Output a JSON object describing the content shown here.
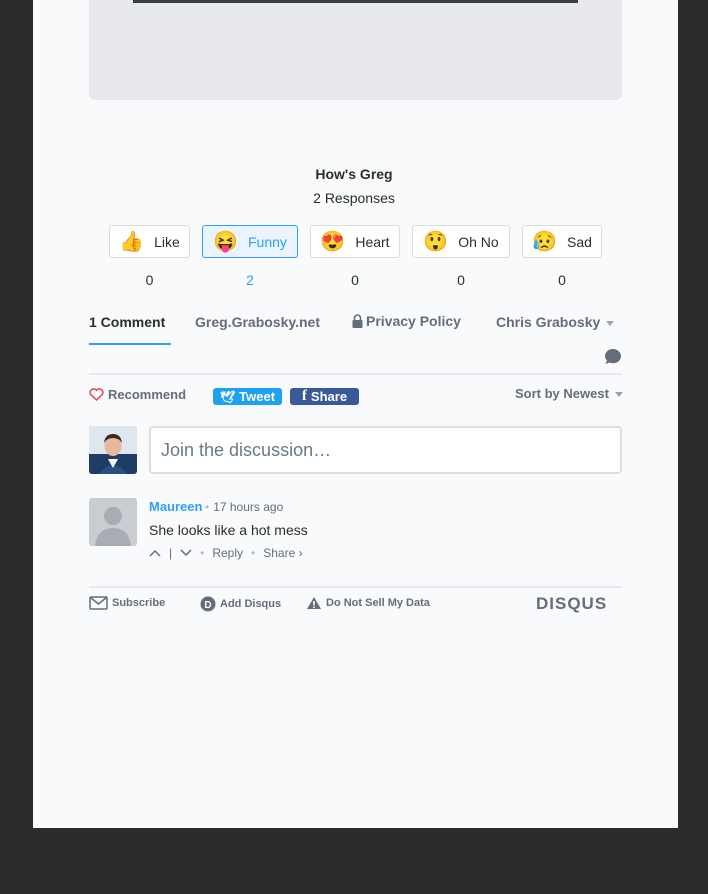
{
  "reactions": {
    "title": "How's Greg",
    "responses": "2 Responses",
    "items": [
      {
        "label": "Like",
        "count": "0",
        "emoji": "👍",
        "icon": "thumbs-up-icon"
      },
      {
        "label": "Funny",
        "count": "2",
        "emoji": "😝",
        "icon": "laughing-face-icon",
        "active": true
      },
      {
        "label": "Heart",
        "count": "0",
        "emoji": "😍",
        "icon": "heart-eyes-icon"
      },
      {
        "label": "Oh No",
        "count": "0",
        "emoji": "😲",
        "icon": "surprised-face-icon"
      },
      {
        "label": "Sad",
        "count": "0",
        "emoji": "😥",
        "icon": "sad-face-icon"
      }
    ],
    "accent_color": "#2e9fff"
  },
  "nav": {
    "comments_tab": "1 Comment",
    "site": "Greg.Grabosky.net",
    "privacy": "Privacy Policy",
    "user": "Chris Grabosky"
  },
  "toolbar": {
    "recommend": "Recommend",
    "tweet": "Tweet",
    "share": "Share",
    "sort": "Sort by Newest"
  },
  "composer": {
    "placeholder": "Join the discussion…"
  },
  "comment": {
    "author": "Maureen",
    "time": "17 hours ago",
    "text": "She looks like a hot mess",
    "reply": "Reply",
    "share": "Share ›"
  },
  "footer": {
    "subscribe": "Subscribe",
    "add_disqus": "Add Disqus",
    "do_not_sell": "Do Not Sell My Data",
    "brand": "DISQUS"
  }
}
